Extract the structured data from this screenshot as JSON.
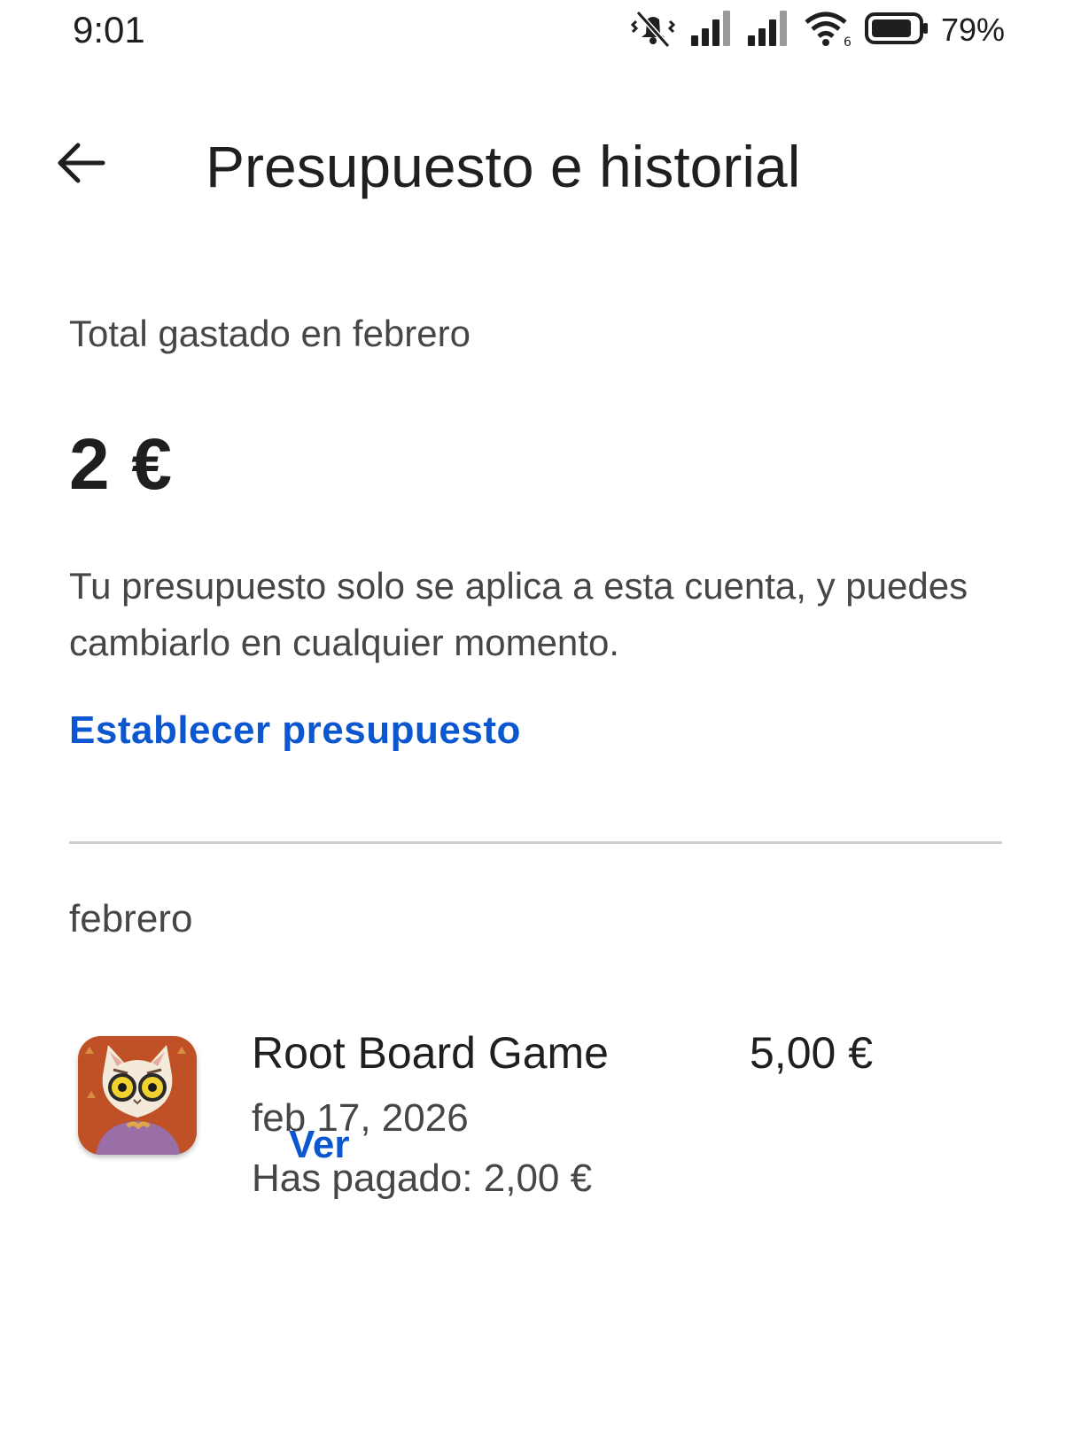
{
  "status_bar": {
    "time": "9:01",
    "battery_percent": "79%",
    "icons": [
      "vibrate-off-icon",
      "signal-icon",
      "signal-icon",
      "wifi-6-icon",
      "battery-icon"
    ]
  },
  "app_bar": {
    "back_icon": "arrow-left-icon",
    "title": "Presupuesto e historial"
  },
  "summary": {
    "label": "Total gastado en febrero",
    "amount": "2 €",
    "note": "Tu presupuesto solo se aplica a esta cuenta, y puedes cambiarlo en cualquier momento.",
    "set_budget_label": "Establecer presupuesto"
  },
  "history": {
    "month": "febrero",
    "items": [
      {
        "title": "Root Board Game",
        "price": "5,00 €",
        "date": "feb 17, 2026",
        "paid": "Has pagado: 2,00 €",
        "view_label": "Ver"
      }
    ]
  },
  "colors": {
    "link": "#0b57d0",
    "text_primary": "#1f1f1f",
    "text_secondary": "#444746",
    "divider": "#cfcfcf",
    "app_icon_bg": "#b84a22"
  }
}
